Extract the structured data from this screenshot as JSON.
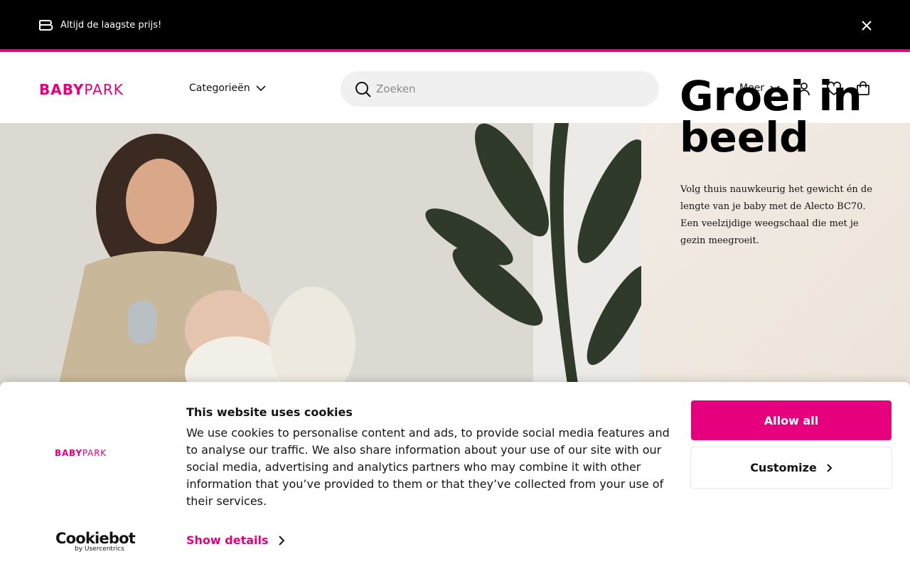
{
  "promo": {
    "text": "Altijd de laagste prijs!",
    "menu_icon": "stacked-bars-icon",
    "close_icon": "close-icon"
  },
  "header": {
    "logo_bold": "BABY",
    "logo_light": "PARK",
    "categories_label": "Categorieën",
    "search_placeholder": "Zoeken",
    "more_label": "Meer",
    "icons": [
      "account-icon",
      "heart-icon",
      "shopping-bag-icon"
    ]
  },
  "hero": {
    "title": "Groei in beeld",
    "text": "Volg thuis nauwkeurig het gewicht én de lengte van je baby met de Alecto BC70. Een veelzijdige weegschaal die met je gezin meegroeit."
  },
  "cookie": {
    "logo_bold": "BABY",
    "logo_light": "PARK",
    "provider_name": "Cookiebot",
    "provider_sub": "by Usercentrics",
    "title": "This website uses cookies",
    "body": "We use cookies to personalise content and ads, to provide social media features and to analyse our traffic. We also share information about your use of our site with our social media, advertising and analytics partners who may combine it with other information that you’ve provided to them or that they’ve collected from your use of their services.",
    "show_details": "Show details",
    "allow_all": "Allow all",
    "customize": "Customize"
  },
  "colors": {
    "brand": "#e6007e",
    "promo_bg": "#000000",
    "search_bg": "#eff0ef"
  }
}
